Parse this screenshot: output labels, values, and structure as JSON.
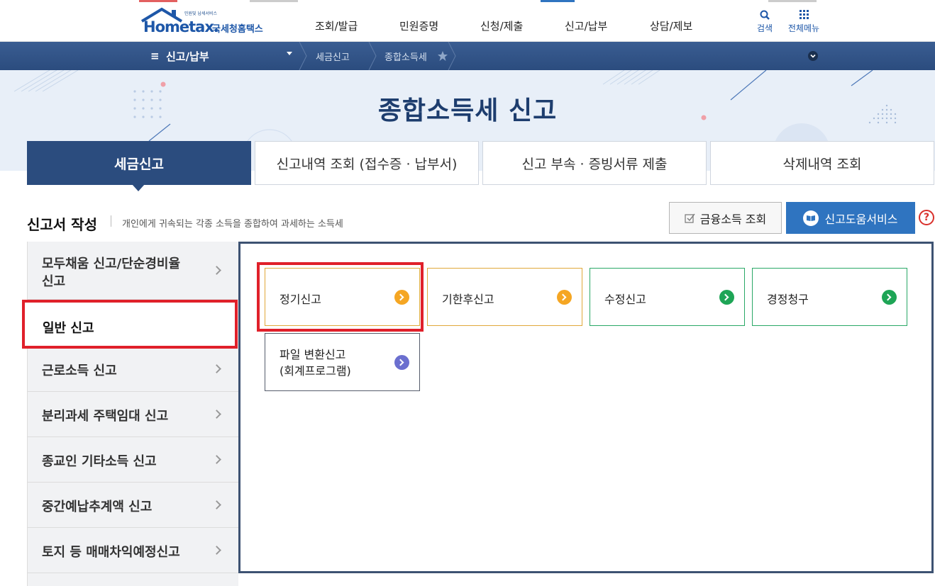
{
  "logo": {
    "brand": "Hometax.",
    "brand_kr": "국세청홈택스",
    "tagline": "민원및 납세서비스"
  },
  "gnb": [
    "조회/발급",
    "민원증명",
    "신청/제출",
    "신고/납부",
    "상담/제보"
  ],
  "utility": {
    "search": "검색",
    "all_menu": "전체메뉴"
  },
  "breadcrumb": {
    "menu": "신고/납부",
    "items": [
      "세금신고",
      "종합소득세"
    ]
  },
  "page": {
    "title": "종합소득세 신고"
  },
  "tabs": [
    "세금신고",
    "신고내역 조회 (접수증 · 납부서)",
    "신고 부속 · 증빙서류 제출",
    "삭제내역 조회"
  ],
  "section": {
    "title": "신고서 작성",
    "desc": "개인에게 귀속되는 각종 소득을 종합하여 과세하는 소득세"
  },
  "buttons": {
    "financial": "금융소득 조회",
    "help": "신고도움서비스",
    "question": "?"
  },
  "lnb": {
    "items": [
      "모두채움 신고/단순경비율 신고",
      "일반 신고",
      "근로소득 신고",
      "분리과세 주택임대 신고",
      "종교인 기타소득 신고",
      "중간예납추계액 신고",
      "토지 등 매매차익예정신고"
    ],
    "item0_line1": "모두채움 신고/단순경비율",
    "item0_line2": "신고"
  },
  "cards": [
    {
      "label": "정기신고"
    },
    {
      "label": "기한후신고"
    },
    {
      "label": "수정신고"
    },
    {
      "label": "경정청구"
    },
    {
      "line1": "파일 변환신고",
      "line2": "(회계프로그램)"
    }
  ],
  "colors": {
    "navy": "#2b4c7e",
    "orange": "#f5a623",
    "green": "#1ea556",
    "purple": "#6b6fcf",
    "highlight": "#e0202a"
  }
}
